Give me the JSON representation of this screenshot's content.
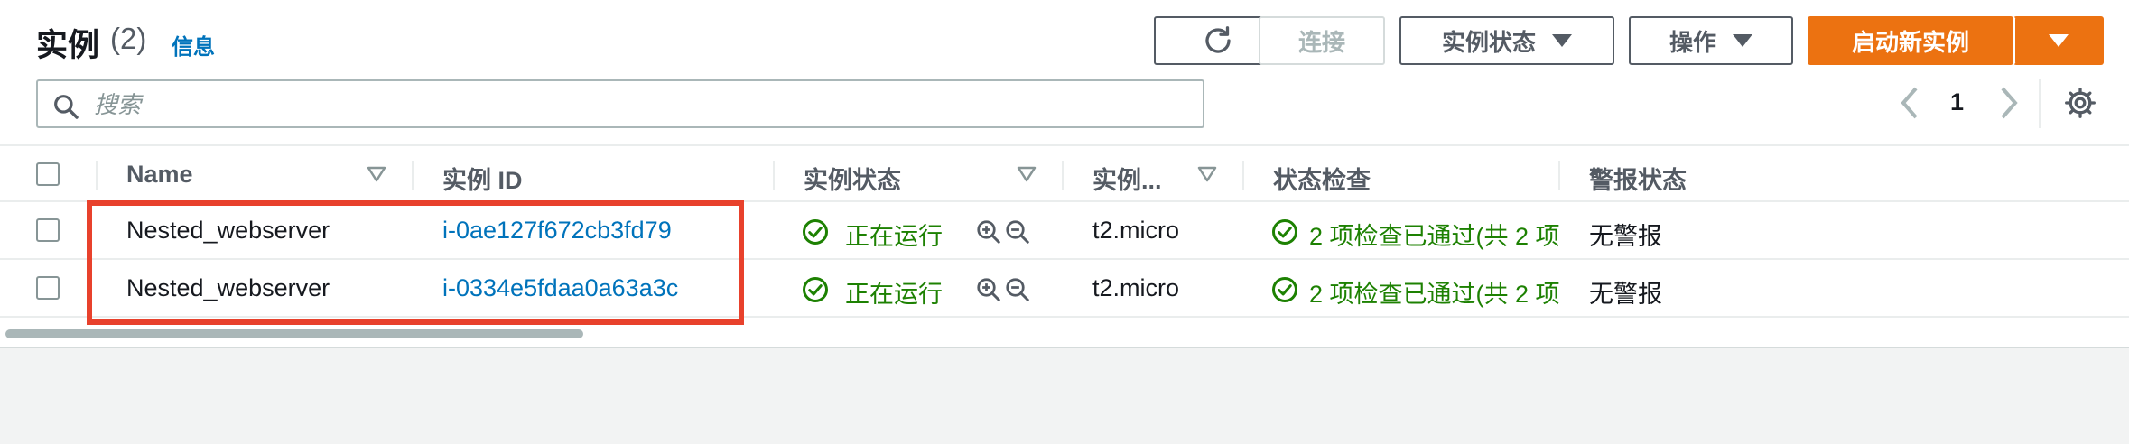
{
  "header": {
    "title": "实例",
    "count": "(2)",
    "info_link": "信息",
    "refresh_icon": "refresh-icon",
    "connect_label": "连接",
    "instance_state_label": "实例状态",
    "actions_label": "操作",
    "launch_label": "启动新实例"
  },
  "search": {
    "placeholder": "搜索",
    "value": ""
  },
  "pager": {
    "current_page": "1"
  },
  "table": {
    "columns": [
      "Name",
      "实例 ID",
      "实例状态",
      "实例...",
      "状态检查",
      "警报状态"
    ],
    "rows": [
      {
        "name": "Nested_webserver",
        "instance_id": "i-0ae127f672cb3fd79",
        "state": "正在运行",
        "type": "t2.micro",
        "status_check": "2 项检查已通过(共 2 项",
        "alarm": "无警报"
      },
      {
        "name": "Nested_webserver",
        "instance_id": "i-0334e5fdaa0a63a3c",
        "state": "正在运行",
        "type": "t2.micro",
        "status_check": "2 项检查已通过(共 2 项",
        "alarm": "无警报"
      }
    ]
  },
  "colors": {
    "accent": "#ec7211",
    "link": "#0073bb",
    "success": "#1d8102",
    "highlight": "#e8412c"
  }
}
